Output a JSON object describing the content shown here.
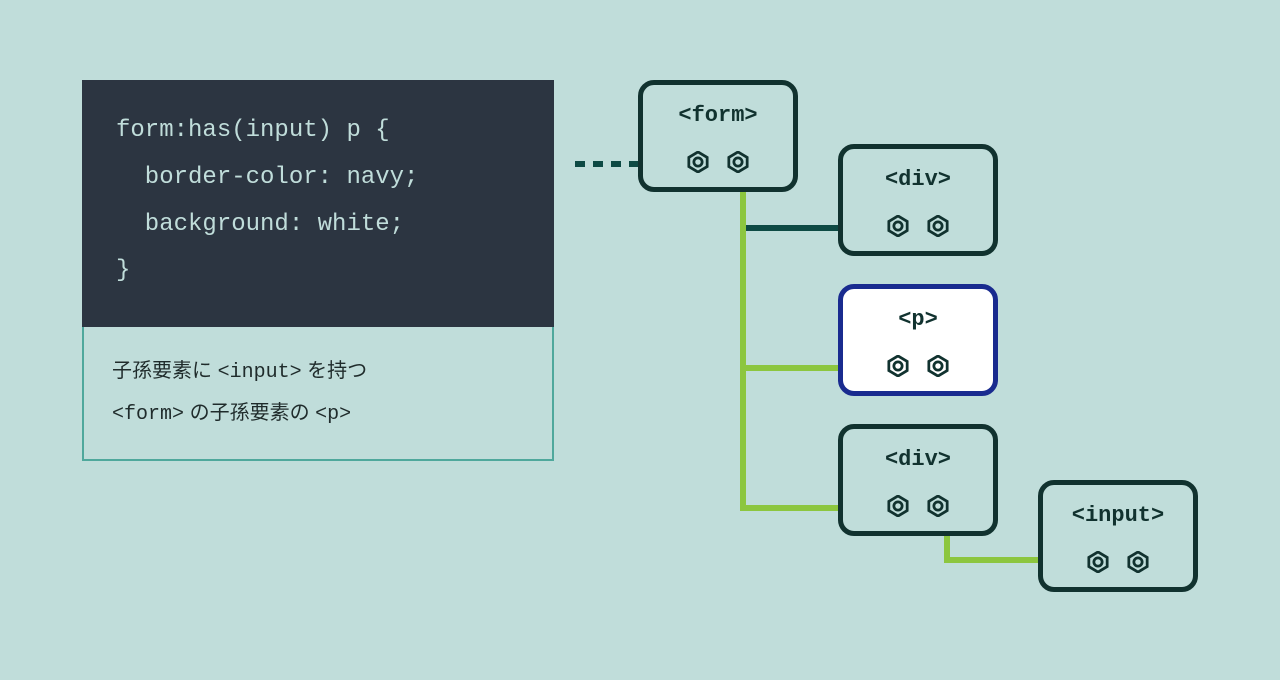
{
  "code": {
    "line1": "form:has(input) p {",
    "line2": "  border-color: navy;",
    "line3": "  background: white;",
    "line4": "}"
  },
  "caption": {
    "line1_pre": "子孫要素に ",
    "line1_mono": "<input>",
    "line1_post": " を持つ",
    "line2_mono1": "<form>",
    "line2_mid": " の子孫要素の ",
    "line2_mono2": "<p>"
  },
  "nodes": {
    "form": "<form>",
    "div1": "<div>",
    "p": "<p>",
    "div2": "<div>",
    "input": "<input>"
  },
  "colors": {
    "bg": "#c0ddda",
    "codeBg": "#2c3541",
    "codeFg": "#c0ddda",
    "border": "#4fa89c",
    "nodeBorder": "#11322f",
    "highlightBorder": "#192b8f",
    "highlightBg": "#ffffff",
    "lineDark": "#0d4a44",
    "lineGreen": "#8cc63f"
  }
}
